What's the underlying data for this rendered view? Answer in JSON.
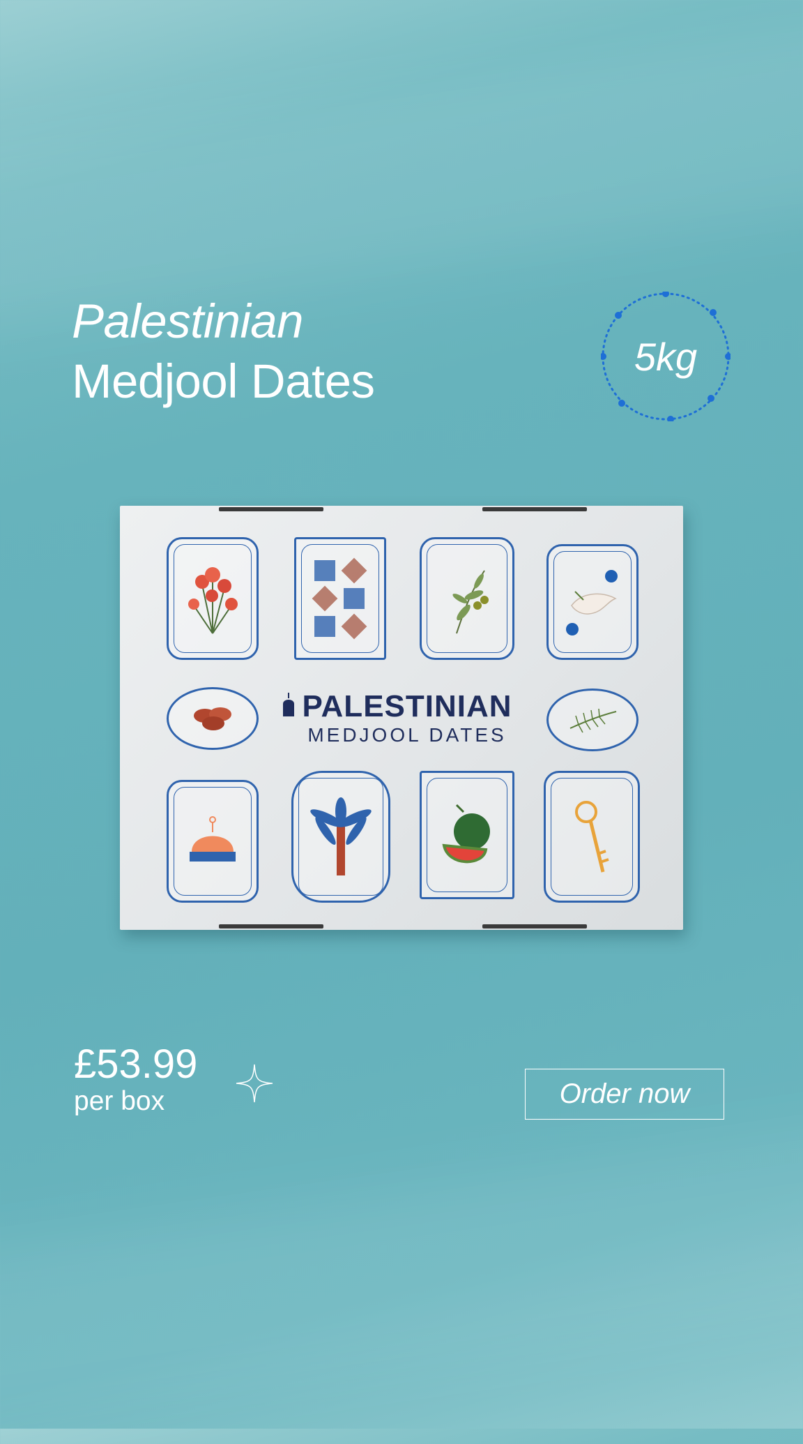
{
  "headline": {
    "line1": "Palestinian",
    "line2": "Medjool Dates"
  },
  "badge": {
    "weight": "5kg"
  },
  "product_box": {
    "brand": "PALESTINIAN",
    "subtitle": "MEDJOOL DATES",
    "tile_icons": [
      "poppy-flowers-icon",
      "tatreez-pattern-icon",
      "olive-branch-icon",
      "dove-icon",
      "dates-icon",
      "palm-leaf-icon",
      "dome-of-the-rock-icon",
      "palm-tree-icon",
      "watermelon-icon",
      "key-of-return-icon"
    ]
  },
  "price": {
    "amount": "£53.99",
    "unit": "per box"
  },
  "cta": {
    "label": "Order now"
  },
  "colors": {
    "background": "#66b2bb",
    "accent_blue": "#2f63ad",
    "badge_dots": "#1e6fd6",
    "text": "#ffffff"
  }
}
